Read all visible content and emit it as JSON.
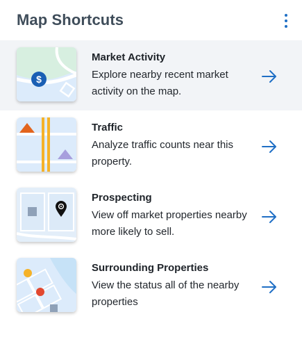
{
  "header": {
    "title": "Map Shortcuts",
    "menu_icon": "more-vertical-icon"
  },
  "colors": {
    "accent": "#1f6fc5",
    "title": "#3f4d5a",
    "active_row_bg": "#f2f4f7"
  },
  "shortcuts": [
    {
      "title": "Market Activity",
      "description": "Explore nearby recent market activity on the map.",
      "icon": "dollar-map-icon",
      "arrow_icon": "arrow-right-icon"
    },
    {
      "title": "Traffic",
      "description": "Analyze traffic counts near this property.",
      "icon": "traffic-map-icon",
      "arrow_icon": "arrow-right-icon"
    },
    {
      "title": "Prospecting",
      "description": "View off market properties nearby more likely to sell.",
      "icon": "prospecting-map-icon",
      "arrow_icon": "arrow-right-icon"
    },
    {
      "title": "Surrounding Properties",
      "description": "View the status all of the nearby properties",
      "icon": "surrounding-map-icon",
      "arrow_icon": "arrow-right-icon"
    }
  ]
}
